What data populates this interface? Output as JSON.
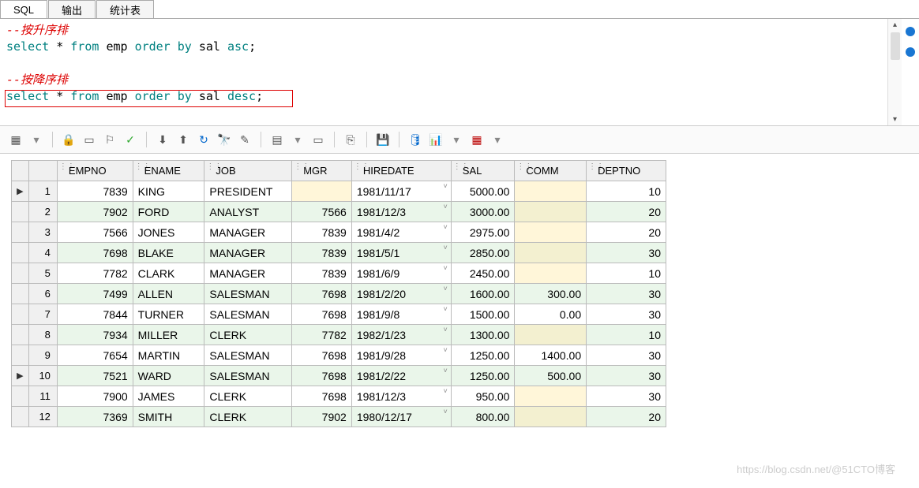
{
  "tabs": {
    "sql": "SQL",
    "output": "输出",
    "stats": "统计表"
  },
  "sql": {
    "comment1": "--按升序排",
    "line1": {
      "select": "select",
      "star": "*",
      "from": "from",
      "emp": "emp",
      "order": "order",
      "by": "by",
      "sal": "sal",
      "asc": "asc",
      "semi": ";"
    },
    "comment2": "--按降序排",
    "line2": {
      "select": "select",
      "star": "*",
      "from": "from",
      "emp": "emp",
      "order": "order",
      "by": "by",
      "sal": "sal",
      "desc": "desc",
      "semi": ";"
    }
  },
  "columns": [
    "",
    "",
    "EMPNO",
    "ENAME",
    "JOB",
    "MGR",
    "HIREDATE",
    "SAL",
    "COMM",
    "DEPTNO"
  ],
  "rows": [
    {
      "n": 1,
      "mark": "▶",
      "empno": "7839",
      "ename": "KING",
      "job": "PRESIDENT",
      "mgr": "",
      "hiredate": "1981/11/17",
      "sal": "5000.00",
      "comm": "",
      "deptno": "10"
    },
    {
      "n": 2,
      "mark": "",
      "empno": "7902",
      "ename": "FORD",
      "job": "ANALYST",
      "mgr": "7566",
      "hiredate": "1981/12/3",
      "sal": "3000.00",
      "comm": "",
      "deptno": "20"
    },
    {
      "n": 3,
      "mark": "",
      "empno": "7566",
      "ename": "JONES",
      "job": "MANAGER",
      "mgr": "7839",
      "hiredate": "1981/4/2",
      "sal": "2975.00",
      "comm": "",
      "deptno": "20"
    },
    {
      "n": 4,
      "mark": "",
      "empno": "7698",
      "ename": "BLAKE",
      "job": "MANAGER",
      "mgr": "7839",
      "hiredate": "1981/5/1",
      "sal": "2850.00",
      "comm": "",
      "deptno": "30"
    },
    {
      "n": 5,
      "mark": "",
      "empno": "7782",
      "ename": "CLARK",
      "job": "MANAGER",
      "mgr": "7839",
      "hiredate": "1981/6/9",
      "sal": "2450.00",
      "comm": "",
      "deptno": "10"
    },
    {
      "n": 6,
      "mark": "",
      "empno": "7499",
      "ename": "ALLEN",
      "job": "SALESMAN",
      "mgr": "7698",
      "hiredate": "1981/2/20",
      "sal": "1600.00",
      "comm": "300.00",
      "deptno": "30"
    },
    {
      "n": 7,
      "mark": "",
      "empno": "7844",
      "ename": "TURNER",
      "job": "SALESMAN",
      "mgr": "7698",
      "hiredate": "1981/9/8",
      "sal": "1500.00",
      "comm": "0.00",
      "deptno": "30"
    },
    {
      "n": 8,
      "mark": "",
      "empno": "7934",
      "ename": "MILLER",
      "job": "CLERK",
      "mgr": "7782",
      "hiredate": "1982/1/23",
      "sal": "1300.00",
      "comm": "",
      "deptno": "10"
    },
    {
      "n": 9,
      "mark": "",
      "empno": "7654",
      "ename": "MARTIN",
      "job": "SALESMAN",
      "mgr": "7698",
      "hiredate": "1981/9/28",
      "sal": "1250.00",
      "comm": "1400.00",
      "deptno": "30"
    },
    {
      "n": 10,
      "mark": "▶",
      "empno": "7521",
      "ename": "WARD",
      "job": "SALESMAN",
      "mgr": "7698",
      "hiredate": "1981/2/22",
      "sal": "1250.00",
      "comm": "500.00",
      "deptno": "30"
    },
    {
      "n": 11,
      "mark": "",
      "empno": "7900",
      "ename": "JAMES",
      "job": "CLERK",
      "mgr": "7698",
      "hiredate": "1981/12/3",
      "sal": "950.00",
      "comm": "",
      "deptno": "30"
    },
    {
      "n": 12,
      "mark": "",
      "empno": "7369",
      "ename": "SMITH",
      "job": "CLERK",
      "mgr": "7902",
      "hiredate": "1980/12/17",
      "sal": "800.00",
      "comm": "",
      "deptno": "20"
    }
  ],
  "colwidths": {
    "empno": 95,
    "ename": 90,
    "job": 110,
    "mgr": 75,
    "hiredate": 125,
    "sal": 80,
    "comm": 90,
    "deptno": 100
  },
  "watermark": "https://blog.csdn.net/@51CTO博客"
}
